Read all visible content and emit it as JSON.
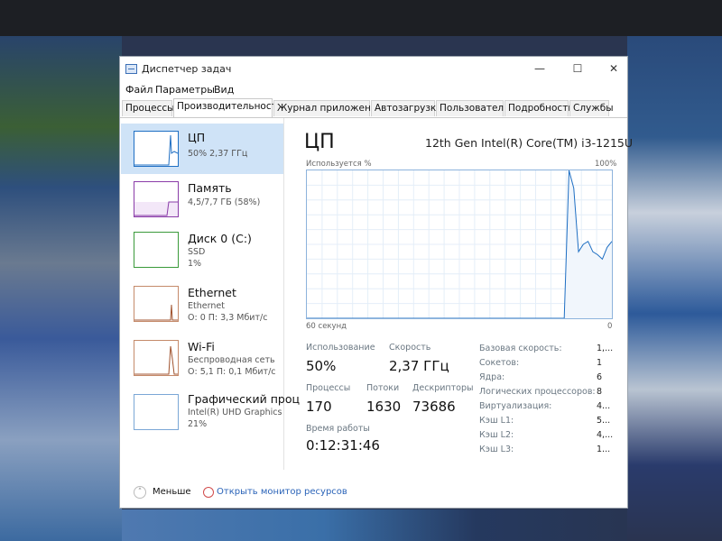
{
  "window": {
    "title": "Диспетчер задач",
    "controls": {
      "minimize": "—",
      "maximize": "☐",
      "close": "✕"
    }
  },
  "menu": [
    "Файл",
    "Параметры",
    "Вид"
  ],
  "tabs": [
    {
      "label": "Процессы"
    },
    {
      "label": "Производительность",
      "active": true
    },
    {
      "label": "Журнал приложений"
    },
    {
      "label": "Автозагрузка"
    },
    {
      "label": "Пользователи"
    },
    {
      "label": "Подробности"
    },
    {
      "label": "Службы"
    }
  ],
  "sidebar": {
    "items": [
      {
        "name": "ЦП",
        "line1": "50% 2,37 ГГц",
        "line2": "",
        "color": "#1f6fc3",
        "active": true
      },
      {
        "name": "Память",
        "line1": "4,5/7,7 ГБ (58%)",
        "line2": "",
        "color": "#8a3ca8"
      },
      {
        "name": "Диск 0 (C:)",
        "line1": "SSD",
        "line2": "1%",
        "color": "#3a9a3a"
      },
      {
        "name": "Ethernet",
        "line1": "Ethernet",
        "line2": "О: 0 П: 3,3 Мбит/с",
        "color": "#a0522d"
      },
      {
        "name": "Wi-Fi",
        "line1": "Беспроводная сеть",
        "line2": "О: 5,1 П: 0,1 Мбит/с",
        "color": "#a0522d"
      },
      {
        "name": "Графический проц",
        "line1": "Intel(R) UHD Graphics",
        "line2": "21%",
        "color": "#2a7ab0"
      }
    ]
  },
  "main": {
    "title": "ЦП",
    "cpu_model": "12th Gen Intel(R) Core(TM) i3-1215U",
    "graph_label_left": "Используется %",
    "graph_label_right": "100%",
    "graph_bottom_left": "60 секунд",
    "graph_bottom_right": "0",
    "stats": {
      "usage_label": "Использование",
      "usage_value": "50%",
      "speed_label": "Скорость",
      "speed_value": "2,37 ГГц",
      "processes_label": "Процессы",
      "processes_value": "170",
      "threads_label": "Потоки",
      "threads_value": "1630",
      "handles_label": "Дескрипторы",
      "handles_value": "73686",
      "uptime_label": "Время работы",
      "uptime_value": "0:12:31:46"
    },
    "specs": [
      {
        "label": "Базовая скорость:",
        "value": "1,..."
      },
      {
        "label": "Сокетов:",
        "value": "1"
      },
      {
        "label": "Ядра:",
        "value": "6"
      },
      {
        "label": "Логических процессоров:",
        "value": "8"
      },
      {
        "label": "Виртуализация:",
        "value": "4..."
      },
      {
        "label": "Кэш L1:",
        "value": "5..."
      },
      {
        "label": "Кэш L2:",
        "value": "4,..."
      },
      {
        "label": "Кэш L3:",
        "value": "1..."
      }
    ]
  },
  "cpu_history": [
    0,
    0,
    0,
    0,
    0,
    0,
    0,
    0,
    0,
    0,
    0,
    0,
    0,
    0,
    0,
    0,
    0,
    0,
    0,
    0,
    0,
    0,
    0,
    0,
    0,
    0,
    0,
    0,
    0,
    0,
    0,
    0,
    0,
    0,
    0,
    0,
    0,
    0,
    0,
    0,
    0,
    0,
    0,
    0,
    0,
    0,
    0,
    0,
    0,
    0,
    0,
    0,
    0,
    0,
    0,
    100,
    88,
    45,
    50,
    52,
    45,
    43,
    40,
    48,
    52
  ],
  "footer": {
    "less_label": "Меньше",
    "monitor_label": "Открыть монитор ресурсов"
  }
}
